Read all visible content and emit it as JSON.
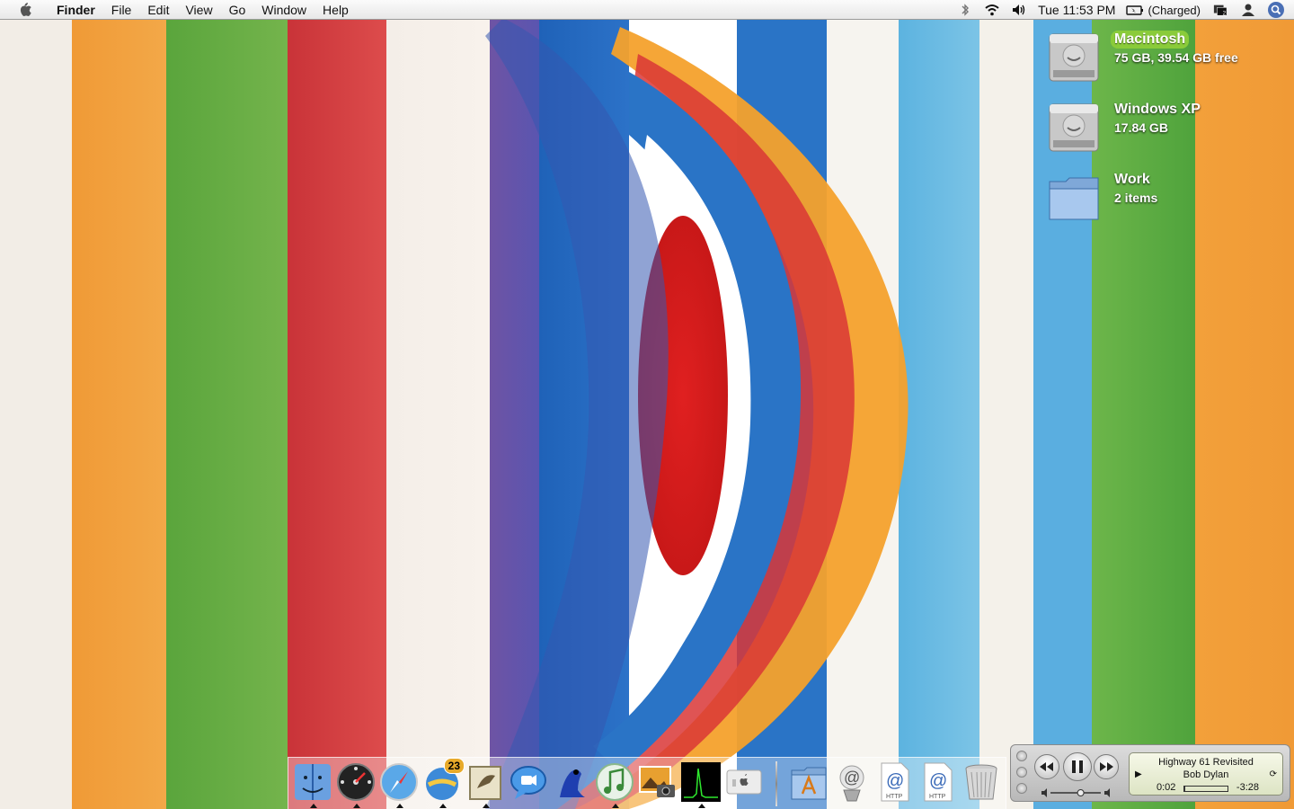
{
  "menubar": {
    "apple_icon": "apple-icon",
    "app_name": "Finder",
    "menus": [
      "File",
      "Edit",
      "View",
      "Go",
      "Window",
      "Help"
    ],
    "status_icons": [
      "bluetooth-icon",
      "wifi-icon",
      "volume-icon"
    ],
    "clock": "Tue 11:53 PM",
    "battery_text": "(Charged)",
    "battery_icon": "battery-icon",
    "extra_icons": [
      "desktop-manager-icon",
      "user-icon",
      "spotlight-icon"
    ]
  },
  "desktop": {
    "items": [
      {
        "name": "Macintosh",
        "info": "75 GB, 39.54 GB free",
        "icon": "hard-drive-icon",
        "selected": true
      },
      {
        "name": "Windows XP",
        "info": "17.84 GB",
        "icon": "hard-drive-icon",
        "selected": false
      },
      {
        "name": "Work",
        "info": "2 items",
        "icon": "folder-icon",
        "selected": false
      }
    ]
  },
  "dock": {
    "apps": [
      {
        "name": "finder-icon",
        "running": true
      },
      {
        "name": "dashboard-icon",
        "running": true
      },
      {
        "name": "safari-icon",
        "running": true
      },
      {
        "name": "ical-icon",
        "running": true,
        "badge": "23"
      },
      {
        "name": "mail-icon",
        "running": true
      },
      {
        "name": "ichat-icon",
        "running": false
      },
      {
        "name": "frog-app-icon",
        "running": false
      },
      {
        "name": "itunes-icon",
        "running": true
      },
      {
        "name": "iphoto-icon",
        "running": false
      },
      {
        "name": "activity-monitor-icon",
        "running": true
      },
      {
        "name": "system-profiler-icon",
        "running": false
      }
    ],
    "others": [
      "applications-folder-icon",
      "at-sign-stack-icon",
      "http-link-icon",
      "http-link-icon",
      "trash-icon"
    ],
    "http_label": "HTTP",
    "colors": {
      "accent": "#8acb3a"
    }
  },
  "player": {
    "song": "Highway 61 Revisited",
    "artist": "Bob Dylan",
    "elapsed": "0:02",
    "remaining": "-3:28",
    "progress": 0.01,
    "volume": 0.6
  }
}
